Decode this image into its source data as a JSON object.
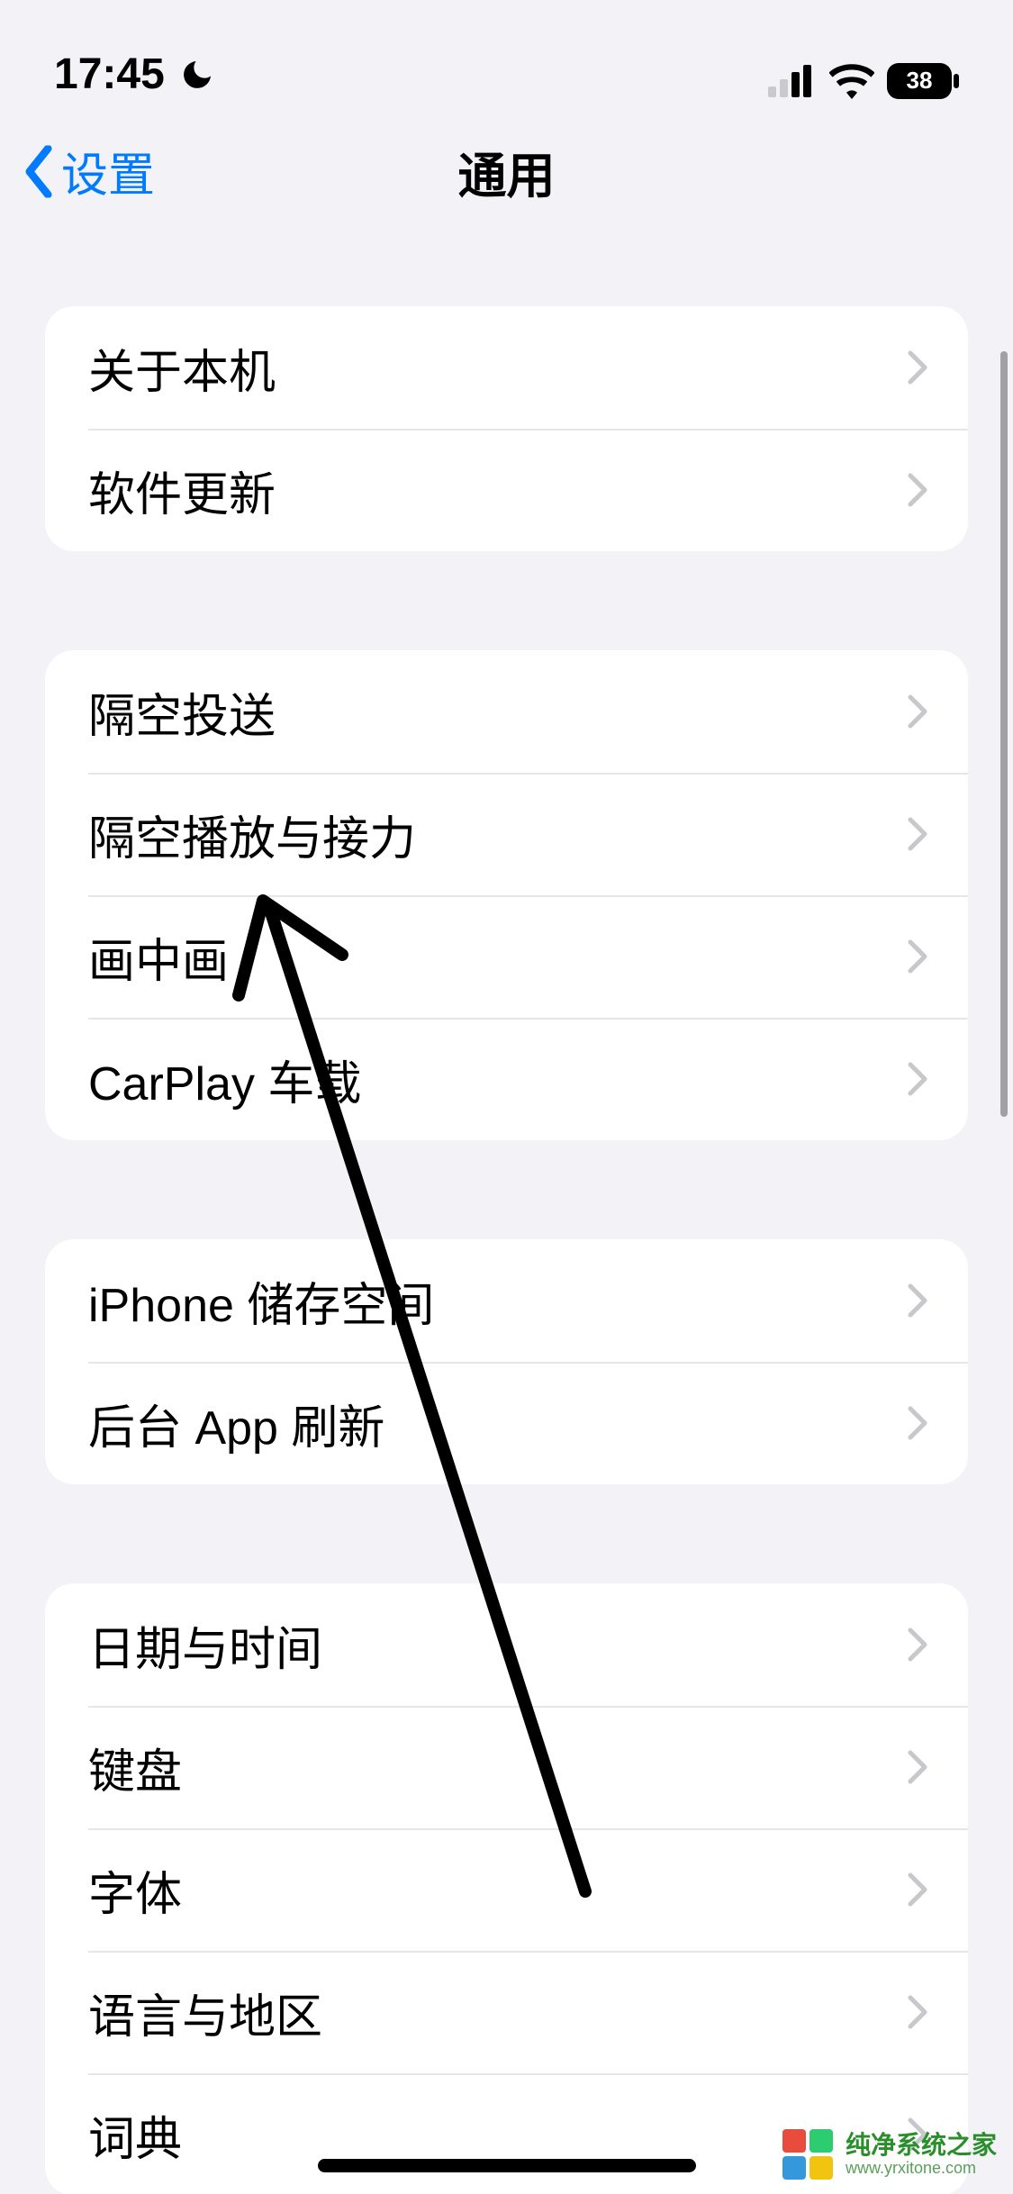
{
  "status": {
    "time": "17:45",
    "battery_text": "38"
  },
  "nav": {
    "back_label": "设置",
    "title": "通用"
  },
  "groups": [
    {
      "items": [
        {
          "label": "关于本机"
        },
        {
          "label": "软件更新"
        }
      ]
    },
    {
      "items": [
        {
          "label": "隔空投送"
        },
        {
          "label": "隔空播放与接力"
        },
        {
          "label": "画中画"
        },
        {
          "label": "CarPlay 车载"
        }
      ]
    },
    {
      "items": [
        {
          "label": "iPhone 储存空间"
        },
        {
          "label": "后台 App 刷新"
        }
      ]
    },
    {
      "items": [
        {
          "label": "日期与时间"
        },
        {
          "label": "键盘"
        },
        {
          "label": "字体"
        },
        {
          "label": "语言与地区"
        },
        {
          "label": "词典"
        }
      ]
    }
  ],
  "watermark": {
    "name": "纯净系统之家",
    "url": "www.yrxitone.com"
  }
}
